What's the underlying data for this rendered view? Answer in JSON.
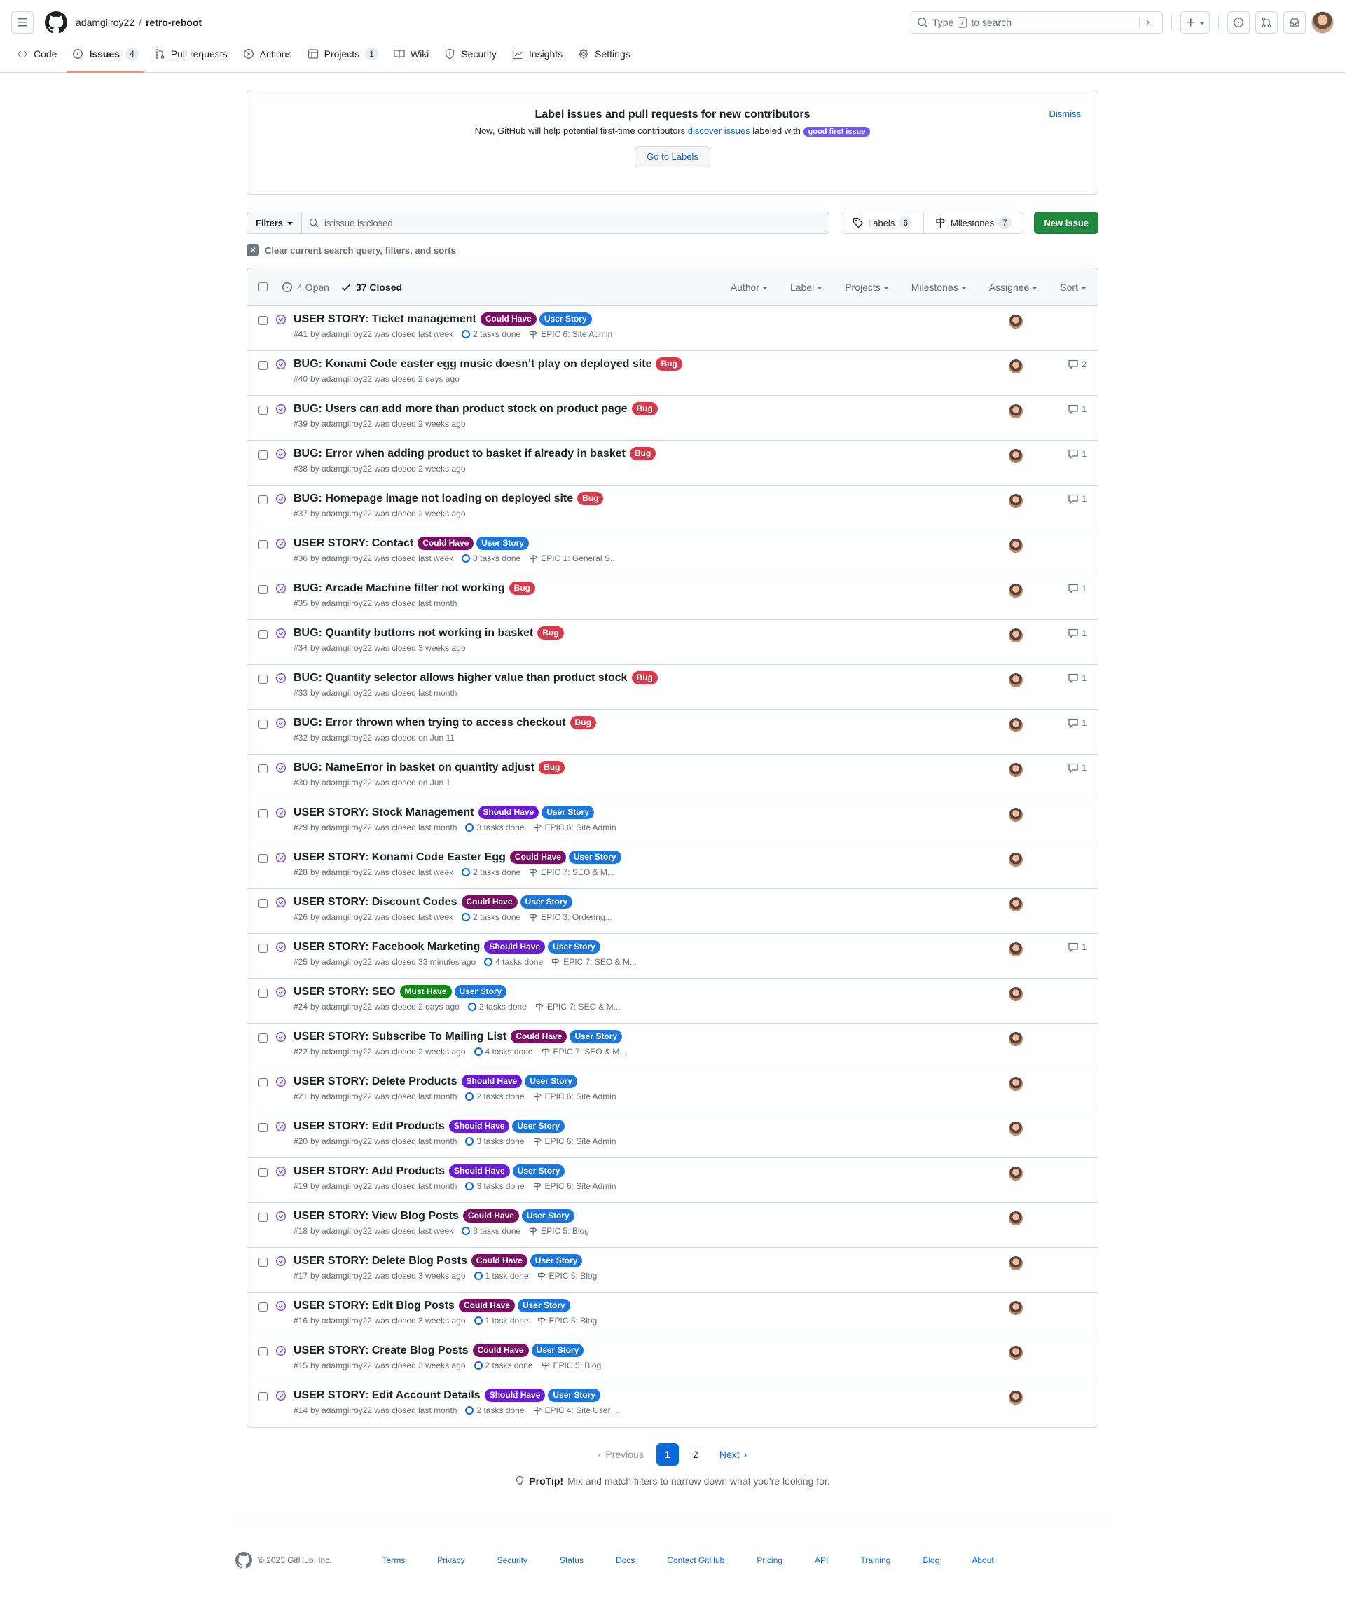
{
  "header": {
    "owner": "adamgilroy22",
    "separator": "/",
    "repo": "retro-reboot",
    "search_prefix": "Type",
    "search_key": "/",
    "search_suffix": "to search"
  },
  "nav": [
    {
      "label": "Code",
      "icon": "code-icon"
    },
    {
      "label": "Issues",
      "icon": "issue-opened-icon",
      "count": "4"
    },
    {
      "label": "Pull requests",
      "icon": "git-pull-request-icon"
    },
    {
      "label": "Actions",
      "icon": "play-icon"
    },
    {
      "label": "Projects",
      "icon": "table-icon",
      "count": "1"
    },
    {
      "label": "Wiki",
      "icon": "book-icon"
    },
    {
      "label": "Security",
      "icon": "shield-icon"
    },
    {
      "label": "Insights",
      "icon": "graph-icon"
    },
    {
      "label": "Settings",
      "icon": "gear-icon"
    }
  ],
  "banner": {
    "title": "Label issues and pull requests for new contributors",
    "text_before": "Now, GitHub will help potential first-time contributors",
    "link": "discover issues",
    "text_after": "labeled with",
    "label": "good first issue",
    "dismiss": "Dismiss",
    "button": "Go to Labels"
  },
  "filterbar": {
    "filters": "Filters",
    "query": "is:issue is:closed",
    "labels": "Labels",
    "labels_count": "6",
    "milestones": "Milestones",
    "milestones_count": "7",
    "new_issue": "New issue",
    "clear": "Clear current search query, filters, and sorts"
  },
  "box": {
    "open": "4 Open",
    "closed": "37 Closed",
    "filters": [
      "Author",
      "Label",
      "Projects",
      "Milestones",
      "Assignee",
      "Sort"
    ]
  },
  "label_colors": {
    "Could Have": "#7b0f65",
    "Should Have": "#6a1cd8",
    "Must Have": "#0e8a16",
    "User Story": "#1d76db",
    "Bug": "#d73a4a"
  },
  "issues": [
    {
      "title": "USER STORY: Ticket management",
      "labels": [
        "Could Have",
        "User Story"
      ],
      "number": "#41",
      "meta": "by adamgilroy22 was closed last week",
      "tasks": "2 tasks done",
      "milestone": "EPIC 6: Site Admin",
      "comments": ""
    },
    {
      "title": "BUG: Konami Code easter egg music doesn't play on deployed site",
      "labels": [
        "Bug"
      ],
      "number": "#40",
      "meta": "by adamgilroy22 was closed 2 days ago",
      "tasks": "",
      "milestone": "",
      "comments": "2"
    },
    {
      "title": "BUG: Users can add more than product stock on product page",
      "labels": [
        "Bug"
      ],
      "number": "#39",
      "meta": "by adamgilroy22 was closed 2 weeks ago",
      "tasks": "",
      "milestone": "",
      "comments": "1"
    },
    {
      "title": "BUG: Error when adding product to basket if already in basket",
      "labels": [
        "Bug"
      ],
      "number": "#38",
      "meta": "by adamgilroy22 was closed 2 weeks ago",
      "tasks": "",
      "milestone": "",
      "comments": "1"
    },
    {
      "title": "BUG: Homepage image not loading on deployed site",
      "labels": [
        "Bug"
      ],
      "number": "#37",
      "meta": "by adamgilroy22 was closed 2 weeks ago",
      "tasks": "",
      "milestone": "",
      "comments": "1"
    },
    {
      "title": "USER STORY: Contact",
      "labels": [
        "Could Have",
        "User Story"
      ],
      "number": "#36",
      "meta": "by adamgilroy22 was closed last week",
      "tasks": "3 tasks done",
      "milestone": "EPIC 1: General S...",
      "comments": ""
    },
    {
      "title": "BUG: Arcade Machine filter not working",
      "labels": [
        "Bug"
      ],
      "number": "#35",
      "meta": "by adamgilroy22 was closed last month",
      "tasks": "",
      "milestone": "",
      "comments": "1"
    },
    {
      "title": "BUG: Quantity buttons not working in basket",
      "labels": [
        "Bug"
      ],
      "number": "#34",
      "meta": "by adamgilroy22 was closed 3 weeks ago",
      "tasks": "",
      "milestone": "",
      "comments": "1"
    },
    {
      "title": "BUG: Quantity selector allows higher value than product stock",
      "labels": [
        "Bug"
      ],
      "number": "#33",
      "meta": "by adamgilroy22 was closed last month",
      "tasks": "",
      "milestone": "",
      "comments": "1"
    },
    {
      "title": "BUG: Error thrown when trying to access checkout",
      "labels": [
        "Bug"
      ],
      "number": "#32",
      "meta": "by adamgilroy22 was closed on Jun 11",
      "tasks": "",
      "milestone": "",
      "comments": "1"
    },
    {
      "title": "BUG: NameError in basket on quantity adjust",
      "labels": [
        "Bug"
      ],
      "number": "#30",
      "meta": "by adamgilroy22 was closed on Jun 1",
      "tasks": "",
      "milestone": "",
      "comments": "1"
    },
    {
      "title": "USER STORY: Stock Management",
      "labels": [
        "Should Have",
        "User Story"
      ],
      "number": "#29",
      "meta": "by adamgilroy22 was closed last month",
      "tasks": "3 tasks done",
      "milestone": "EPIC 6: Site Admin",
      "comments": ""
    },
    {
      "title": "USER STORY: Konami Code Easter Egg",
      "labels": [
        "Could Have",
        "User Story"
      ],
      "number": "#28",
      "meta": "by adamgilroy22 was closed last week",
      "tasks": "2 tasks done",
      "milestone": "EPIC 7: SEO & M...",
      "comments": ""
    },
    {
      "title": "USER STORY: Discount Codes",
      "labels": [
        "Could Have",
        "User Story"
      ],
      "number": "#26",
      "meta": "by adamgilroy22 was closed last week",
      "tasks": "2 tasks done",
      "milestone": "EPIC 3: Ordering...",
      "comments": ""
    },
    {
      "title": "USER STORY: Facebook Marketing",
      "labels": [
        "Should Have",
        "User Story"
      ],
      "number": "#25",
      "meta": "by adamgilroy22 was closed 33 minutes ago",
      "tasks": "4 tasks done",
      "milestone": "EPIC 7: SEO & M...",
      "comments": "1"
    },
    {
      "title": "USER STORY: SEO",
      "labels": [
        "Must Have",
        "User Story"
      ],
      "number": "#24",
      "meta": "by adamgilroy22 was closed 2 days ago",
      "tasks": "2 tasks done",
      "milestone": "EPIC 7: SEO & M...",
      "comments": ""
    },
    {
      "title": "USER STORY: Subscribe To Mailing List",
      "labels": [
        "Could Have",
        "User Story"
      ],
      "number": "#22",
      "meta": "by adamgilroy22 was closed 2 weeks ago",
      "tasks": "4 tasks done",
      "milestone": "EPIC 7: SEO & M...",
      "comments": ""
    },
    {
      "title": "USER STORY: Delete Products",
      "labels": [
        "Should Have",
        "User Story"
      ],
      "number": "#21",
      "meta": "by adamgilroy22 was closed last month",
      "tasks": "2 tasks done",
      "milestone": "EPIC 6: Site Admin",
      "comments": ""
    },
    {
      "title": "USER STORY: Edit Products",
      "labels": [
        "Should Have",
        "User Story"
      ],
      "number": "#20",
      "meta": "by adamgilroy22 was closed last month",
      "tasks": "3 tasks done",
      "milestone": "EPIC 6: Site Admin",
      "comments": ""
    },
    {
      "title": "USER STORY: Add Products",
      "labels": [
        "Should Have",
        "User Story"
      ],
      "number": "#19",
      "meta": "by adamgilroy22 was closed last month",
      "tasks": "3 tasks done",
      "milestone": "EPIC 6: Site Admin",
      "comments": ""
    },
    {
      "title": "USER STORY: View Blog Posts",
      "labels": [
        "Could Have",
        "User Story"
      ],
      "number": "#18",
      "meta": "by adamgilroy22 was closed last week",
      "tasks": "3 tasks done",
      "milestone": "EPIC 5: Blog",
      "comments": ""
    },
    {
      "title": "USER STORY: Delete Blog Posts",
      "labels": [
        "Could Have",
        "User Story"
      ],
      "number": "#17",
      "meta": "by adamgilroy22 was closed 3 weeks ago",
      "tasks": "1 task done",
      "milestone": "EPIC 5: Blog",
      "comments": ""
    },
    {
      "title": "USER STORY: Edit Blog Posts",
      "labels": [
        "Could Have",
        "User Story"
      ],
      "number": "#16",
      "meta": "by adamgilroy22 was closed 3 weeks ago",
      "tasks": "1 task done",
      "milestone": "EPIC 5: Blog",
      "comments": ""
    },
    {
      "title": "USER STORY: Create Blog Posts",
      "labels": [
        "Could Have",
        "User Story"
      ],
      "number": "#15",
      "meta": "by adamgilroy22 was closed 3 weeks ago",
      "tasks": "2 tasks done",
      "milestone": "EPIC 5: Blog",
      "comments": ""
    },
    {
      "title": "USER STORY: Edit Account Details",
      "labels": [
        "Should Have",
        "User Story"
      ],
      "number": "#14",
      "meta": "by adamgilroy22 was closed last month",
      "tasks": "2 tasks done",
      "milestone": "EPIC 4: Site User ...",
      "comments": ""
    }
  ],
  "pagination": {
    "previous": "Previous",
    "pages": [
      "1",
      "2"
    ],
    "current": "1",
    "next": "Next"
  },
  "protip": {
    "bold": "ProTip!",
    "text": "Mix and match filters to narrow down what you're looking for."
  },
  "footer": {
    "copyright": "© 2023 GitHub, Inc.",
    "links": [
      "Terms",
      "Privacy",
      "Security",
      "Status",
      "Docs",
      "Contact GitHub",
      "Pricing",
      "API",
      "Training",
      "Blog",
      "About"
    ]
  }
}
